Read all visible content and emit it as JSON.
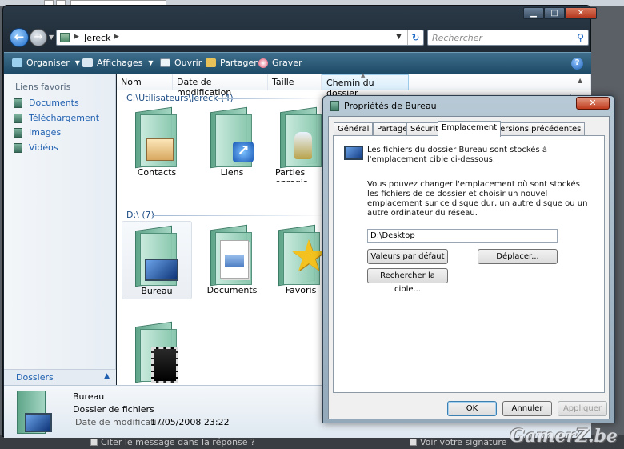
{
  "explorer": {
    "address": {
      "crumb": "Jereck"
    },
    "search": {
      "placeholder": "Rechercher"
    },
    "toolbar": [
      {
        "label": "Organiser",
        "has_dropdown": true
      },
      {
        "label": "Affichages",
        "has_dropdown": true
      },
      {
        "label": "Ouvrir"
      },
      {
        "label": "Partager"
      },
      {
        "label": "Graver"
      }
    ],
    "nav": {
      "favorites_heading": "Liens favoris",
      "items": [
        "Documents",
        "Téléchargement",
        "Images",
        "Vidéos"
      ],
      "folders_label": "Dossiers"
    },
    "columns": [
      "Nom",
      "Date de modification",
      "Taille",
      "Chemin du dossier"
    ],
    "groups": [
      {
        "heading": "C:\\Utilisateurs\\Jereck (4)",
        "items": [
          "Contacts",
          "Liens",
          "Parties enregis"
        ]
      },
      {
        "heading": "D:\\ (7)",
        "items": [
          "Bureau",
          "Documents",
          "Favoris",
          ""
        ]
      }
    ],
    "selected_item": "Bureau",
    "details": {
      "name": "Bureau",
      "type": "Dossier de fichiers",
      "date_label": "Date de modificati...",
      "date_value": "17/05/2008 23:22"
    }
  },
  "dialog": {
    "title": "Propriétés de Bureau",
    "tabs": [
      "Général",
      "Partage",
      "Sécurité",
      "Emplacement",
      "Versions précédentes"
    ],
    "active_tab": "Emplacement",
    "intro": "Les fichiers du dossier Bureau sont stockés à l'emplacement cible ci-dessous.",
    "explanation": "Vous pouvez changer l'emplacement où sont stockés les fichiers de ce dossier et choisir un nouvel emplacement sur ce disque dur, un autre disque ou un autre ordinateur du réseau.",
    "path": "D:\\Desktop",
    "buttons": {
      "restore_default": "Valeurs par défaut",
      "move": "Déplacer...",
      "find_target": "Rechercher la cible...",
      "ok": "OK",
      "cancel": "Annuler",
      "apply": "Appliquer"
    }
  },
  "background": {
    "forum_checkbox_1": "Citer le message dans la réponse ?",
    "forum_checkbox_2": "Voir votre signature",
    "watermark": "GamerZ.be"
  },
  "colors": {
    "link_blue": "#1e5fb0",
    "toolbar": "#2a5a78",
    "folder_green": "#8ecdb4"
  }
}
